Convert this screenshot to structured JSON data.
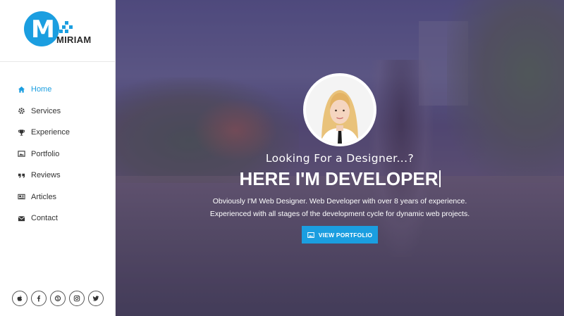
{
  "brand": {
    "name": "MIRIAM",
    "logo_letter": "M",
    "accent_color": "#1b9ee0"
  },
  "nav": {
    "items": [
      {
        "label": "Home",
        "icon": "home-icon",
        "active": true
      },
      {
        "label": "Services",
        "icon": "gear-icon",
        "active": false
      },
      {
        "label": "Experience",
        "icon": "trophy-icon",
        "active": false
      },
      {
        "label": "Portfolio",
        "icon": "image-icon",
        "active": false
      },
      {
        "label": "Reviews",
        "icon": "quote-icon",
        "active": false
      },
      {
        "label": "Articles",
        "icon": "newspaper-icon",
        "active": false
      },
      {
        "label": "Contact",
        "icon": "envelope-icon",
        "active": false
      }
    ]
  },
  "social": [
    "apple-icon",
    "facebook-icon",
    "skype-icon",
    "instagram-icon",
    "twitter-icon"
  ],
  "hero": {
    "subtitle": "Looking For a Designer...?",
    "headline": "HERE I'M DEVELOPER",
    "description": "Obviously I'M Web Designer. Web Developer with over 8 years of experience. Experienced with all stages of the development cycle for dynamic web projects.",
    "cta_label": "VIEW PORTFOLIO"
  }
}
